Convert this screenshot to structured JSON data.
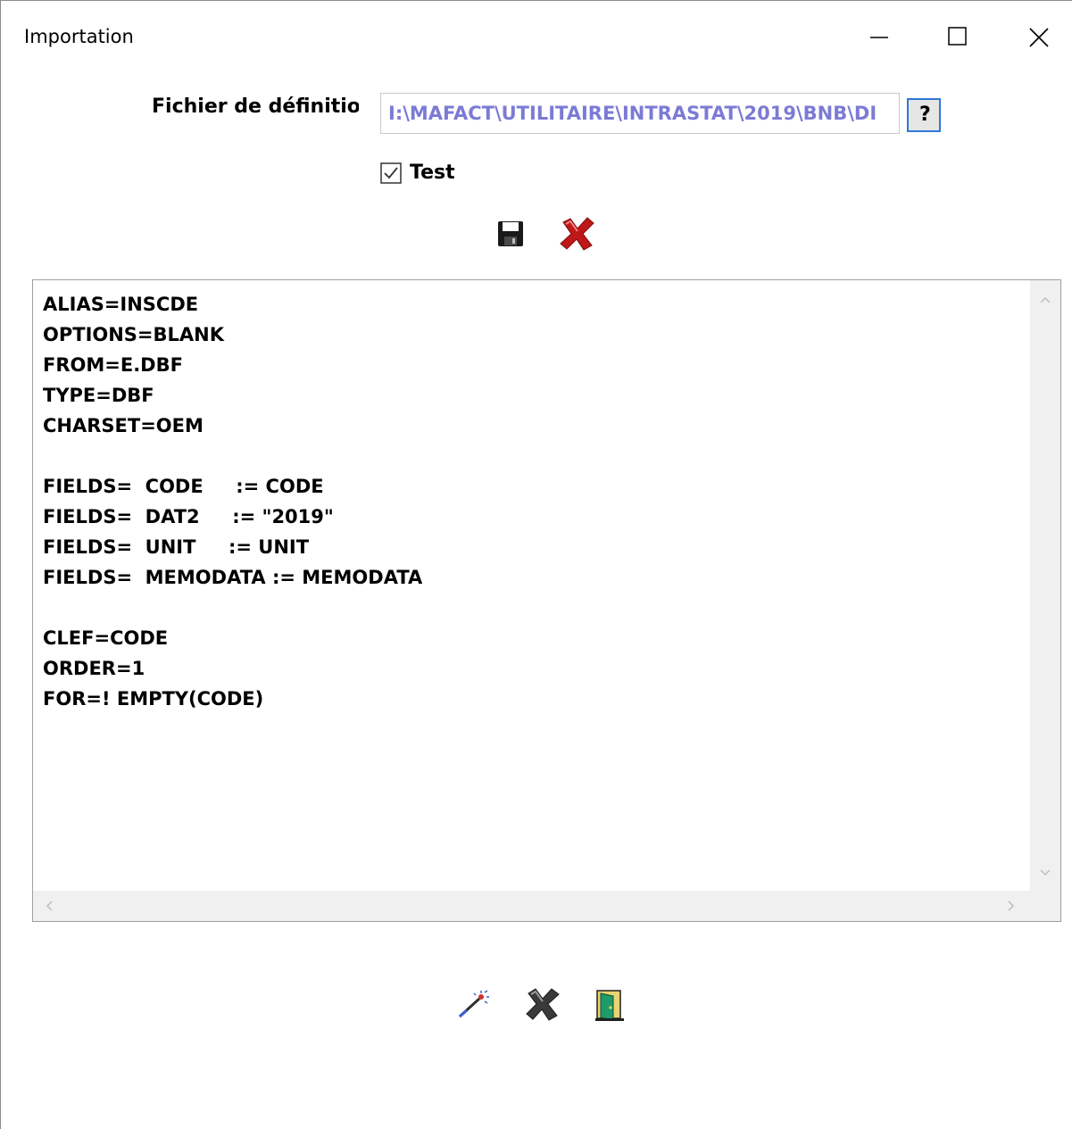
{
  "window": {
    "title": "Importation"
  },
  "titlebar_buttons": {
    "minimize_icon": "minimize-icon",
    "maximize_icon": "maximize-icon",
    "close_icon": "close-icon"
  },
  "definition": {
    "label": "Fichier de définitior",
    "path_value": "I:\\MAFACT\\UTILITAIRE\\INTRASTAT\\2019\\BNB\\DI",
    "browse_label": "?"
  },
  "test_option": {
    "label": "Test",
    "checked": true
  },
  "toolbar": {
    "save_icon": "floppy-disk-icon",
    "cancel_icon": "red-x-icon"
  },
  "editor": {
    "content": "ALIAS=INSCDE\nOPTIONS=BLANK\nFROM=E.DBF\nTYPE=DBF\nCHARSET=OEM\n\nFIELDS=  CODE     := CODE\nFIELDS=  DAT2     := \"2019\"\nFIELDS=  UNIT     := UNIT\nFIELDS=  MEMODATA := MEMODATA\n\nCLEF=CODE\nORDER=1\nFOR=! EMPTY(CODE)"
  },
  "bottom_toolbar": {
    "run_icon": "magic-wand-icon",
    "cancel_icon": "grey-x-icon",
    "exit_icon": "exit-door-icon"
  },
  "colors": {
    "path_text": "#7b7bd6",
    "help_border": "#2e78d6",
    "cancel_red": "#c01818"
  }
}
